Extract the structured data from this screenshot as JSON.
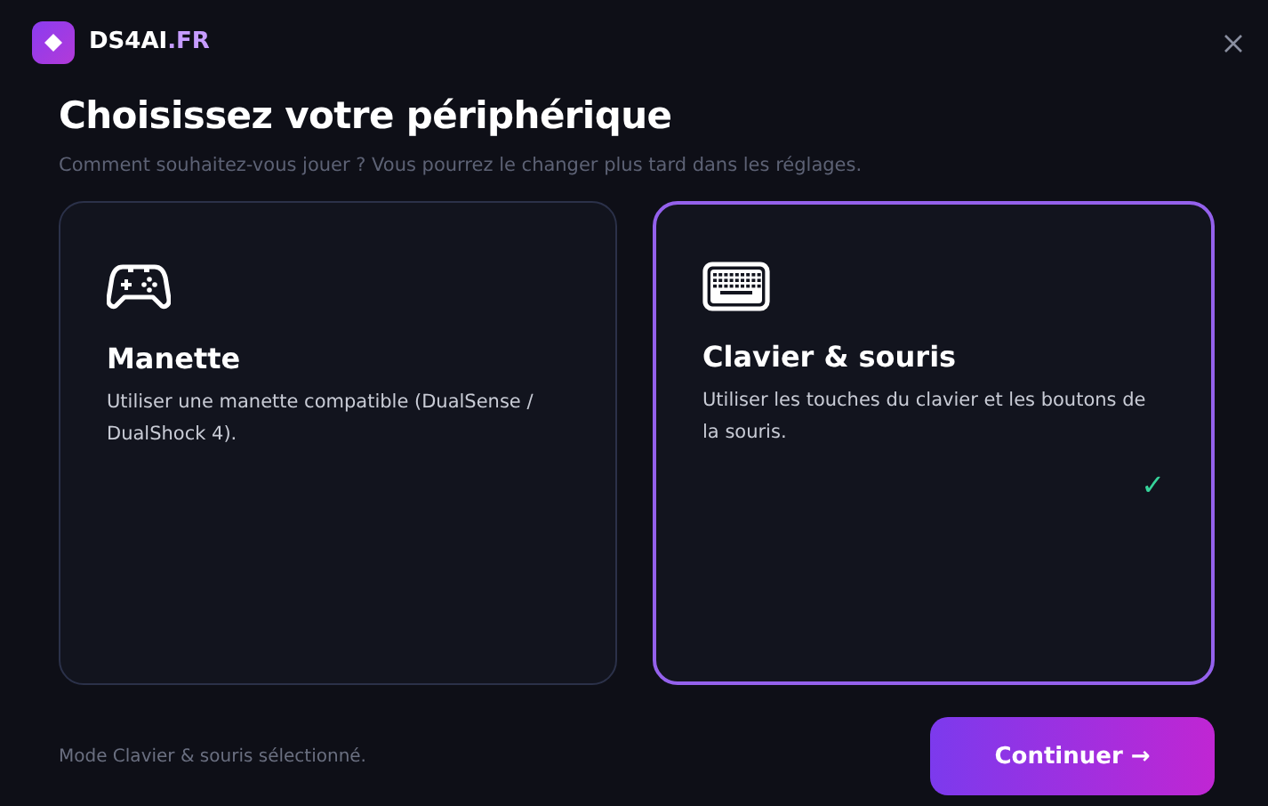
{
  "brand": {
    "name": "DS4AI",
    "suffix": ".FR"
  },
  "title": "Choisissez votre périphérique",
  "subtitle": "Comment souhaitez-vous jouer ? Vous pourrez le changer plus tard dans les réglages.",
  "devices": [
    {
      "kind": "gamepad",
      "title": "Manette",
      "description": "Utiliser une manette compatible (DualSense / DualShock 4).",
      "selected": false
    },
    {
      "kind": "keyboard",
      "title": "Clavier & souris",
      "description": "Utiliser les touches du clavier et les boutons de la souris.",
      "selected": true
    }
  ],
  "check_mark": "✓",
  "status": "Mode Clavier & souris sélectionné.",
  "continue_button": "Continuer →"
}
